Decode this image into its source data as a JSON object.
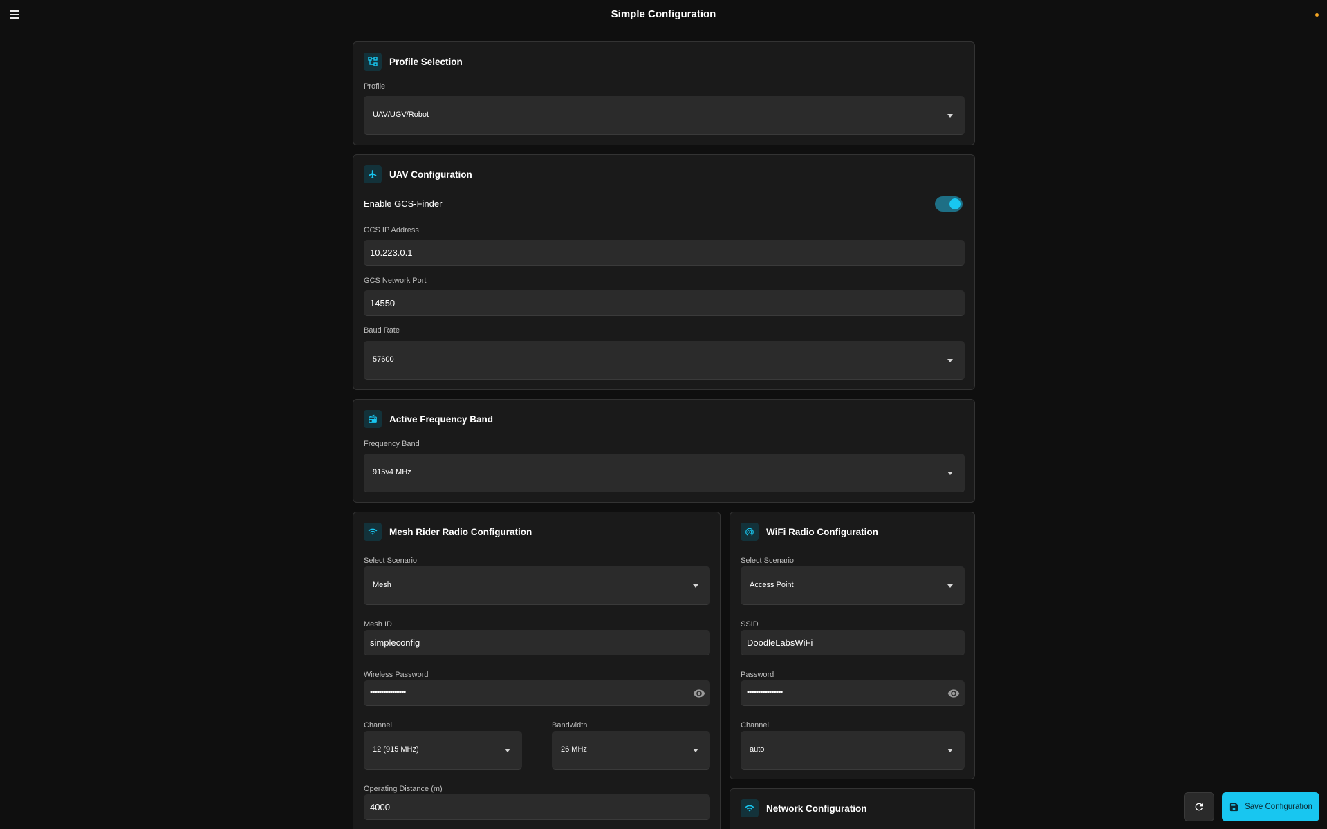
{
  "app": {
    "title": "Simple Configuration",
    "status_dot_color": "#f5a623",
    "accent_color": "#18c6f0"
  },
  "profile_selection": {
    "title": "Profile Selection",
    "icon": "device-hub-icon",
    "profile_label": "Profile",
    "profile_value": "UAV/UGV/Robot"
  },
  "uav_configuration": {
    "title": "UAV Configuration",
    "icon": "airplane-icon",
    "gcs_finder_label": "Enable GCS-Finder",
    "gcs_finder_enabled": true,
    "gcs_ip_label": "GCS IP Address",
    "gcs_ip_value": "10.223.0.1",
    "gcs_port_label": "GCS Network Port",
    "gcs_port_value": "14550",
    "baud_rate_label": "Baud Rate",
    "baud_rate_value": "57600"
  },
  "frequency_band": {
    "title": "Active Frequency Band",
    "icon": "radio-icon",
    "label": "Frequency Band",
    "value": "915v4 MHz"
  },
  "mesh_rider": {
    "title": "Mesh Rider Radio Configuration",
    "icon": "wifi-icon",
    "scenario_label": "Select Scenario",
    "scenario_value": "Mesh",
    "mesh_id_label": "Mesh ID",
    "mesh_id_value": "simpleconfig",
    "password_label": "Wireless Password",
    "password_masked": "••••••••••••••••",
    "channel_label": "Channel",
    "channel_value": "12 (915 MHz)",
    "bandwidth_label": "Bandwidth",
    "bandwidth_value": "26 MHz",
    "distance_label": "Operating Distance (m)",
    "distance_value": "4000"
  },
  "wifi_radio": {
    "title": "WiFi Radio Configuration",
    "icon": "wifi-tethering-icon",
    "scenario_label": "Select Scenario",
    "scenario_value": "Access Point",
    "ssid_label": "SSID",
    "ssid_value": "DoodleLabsWiFi",
    "password_label": "Password",
    "password_masked": "••••••••••••••••",
    "channel_label": "Channel",
    "channel_value": "auto"
  },
  "network_configuration": {
    "title": "Network Configuration",
    "icon": "wifi-icon"
  },
  "actions": {
    "refresh_icon": "refresh-icon",
    "save_label": "Save Configuration",
    "save_icon": "save-icon"
  }
}
